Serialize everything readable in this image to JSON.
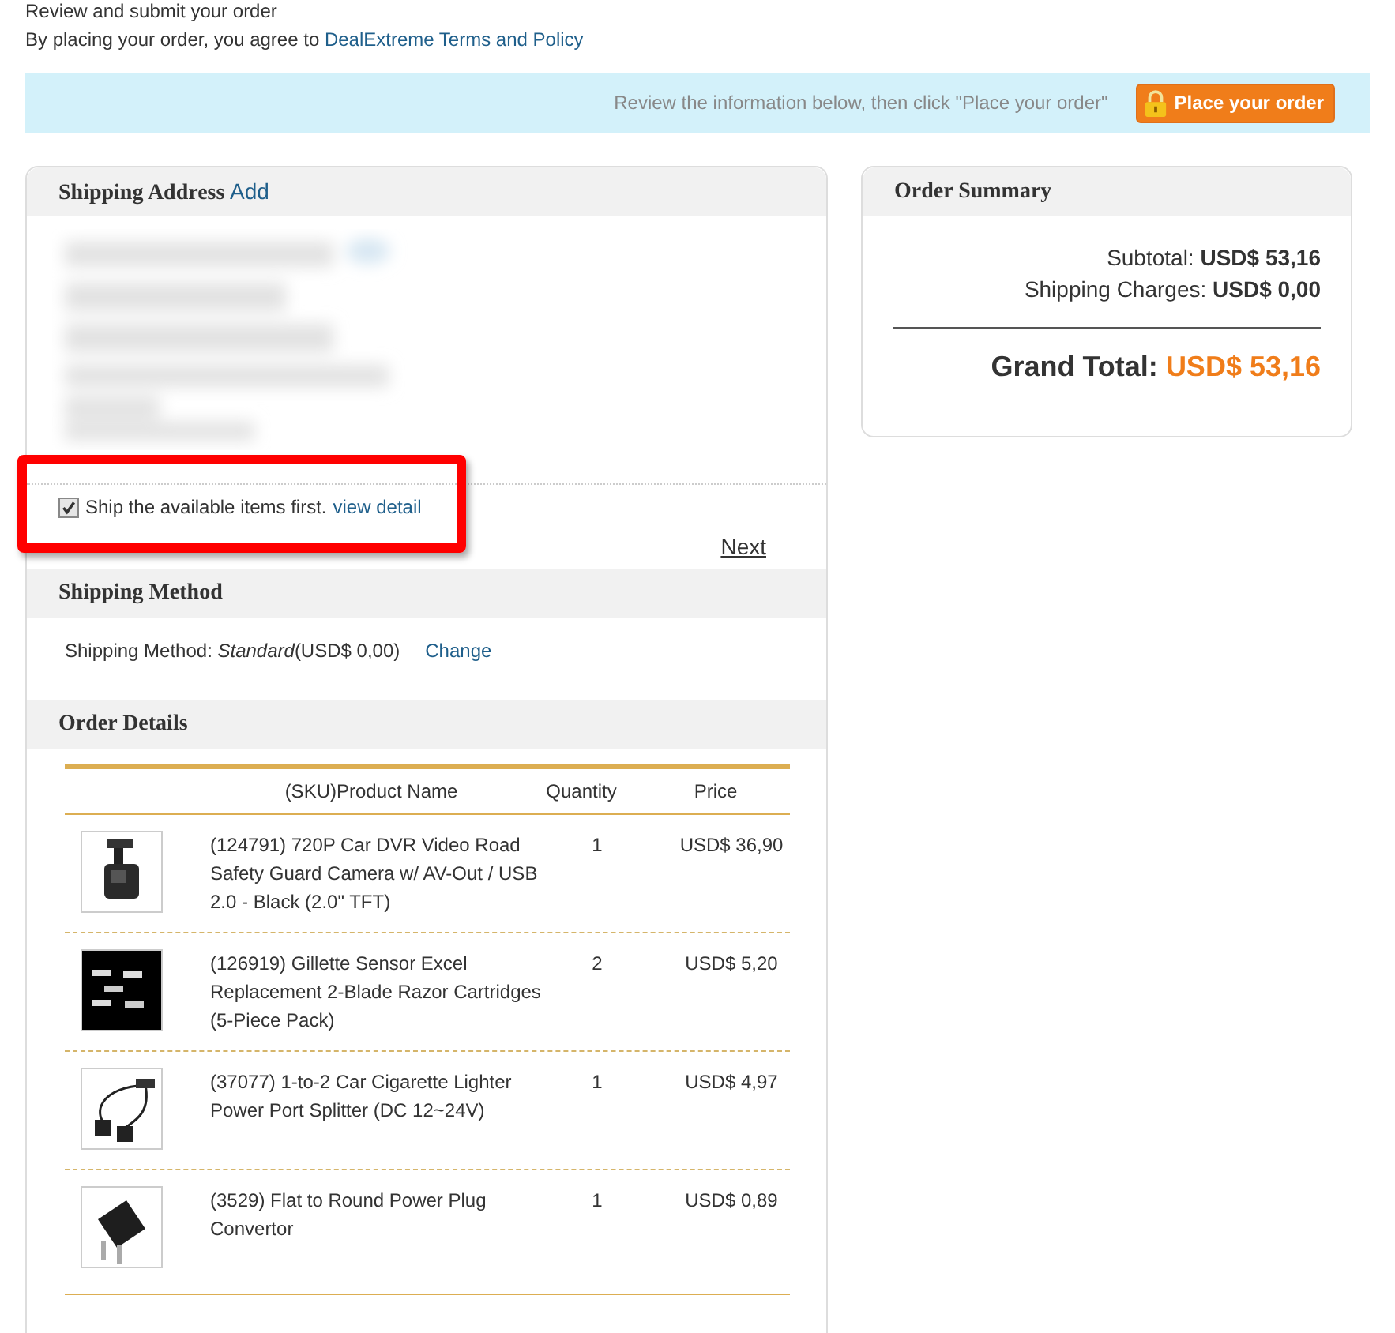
{
  "header": {
    "title": "Review and submit your order",
    "agreement": {
      "text": "By placing your order, you agree to",
      "link": "DealExtreme Terms and Policy"
    }
  },
  "banner": {
    "message": "Review the information below, then click \"Place your order\"",
    "button": "Place your order"
  },
  "shipping_address": {
    "title": "Shipping Address",
    "add_link": "Add",
    "ship_available_first": {
      "label": "Ship the available items first.",
      "link": "view detail",
      "checked": true
    },
    "next": "Next"
  },
  "shipping_method": {
    "title": "Shipping Method",
    "text": "Shipping Method: *Standard*(USD$ 0,00)",
    "change": "Change"
  },
  "order_details": {
    "title": "Order Details",
    "columns": [
      "(SKU)Product Name",
      "Quantity",
      "Price"
    ],
    "rows": [
      {
        "product": "(124791) 720P Car DVR Video Road Safety Guard Camera w/ AV-Out / USB 2.0 - Black (2.0\" TFT)",
        "quantity": "1",
        "price": "USD$ 36,90"
      },
      {
        "product": "(126919) Gillette Sensor Excel Replacement 2-Blade Razor Cartridges (5-Piece Pack)",
        "quantity": "2",
        "price": "USD$ 5,20"
      },
      {
        "product": "(37077) 1-to-2 Car Cigarette Lighter Power Port Splitter (DC 12~24V)",
        "quantity": "1",
        "price": "USD$ 4,97"
      },
      {
        "product": "(3529) Flat to Round Power Plug Convertor",
        "quantity": "1",
        "price": "USD$ 0,89"
      }
    ]
  },
  "order_summary": {
    "title": "Order Summary",
    "subtotal": "Subtotal: **USD$ 53,16**",
    "shipping": "Shipping Charges: **USD$ 0,00**",
    "grand_total": {
      "label": "Grand Total:",
      "value": "USD$ 53,16"
    }
  }
}
